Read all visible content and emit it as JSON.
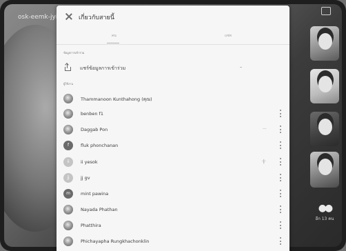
{
  "meeting": {
    "code": "osk-eemk-jyi"
  },
  "panel": {
    "title": "เกี่ยวกับสายนี้",
    "tabs": [
      "คน",
      "แชท"
    ],
    "section_share": "ข้อมูลการเข้าร่วม",
    "share_label": "แชร์ข้อมูลการเข้าร่วม",
    "section_people": "ผู้ใช้งาน"
  },
  "people": [
    {
      "name": "Thammanoon Kunthahong (คุณ)",
      "avatar": "photo",
      "initial": "",
      "extra": "",
      "menu": false
    },
    {
      "name": "benben f1",
      "avatar": "photo",
      "initial": "",
      "extra": "",
      "menu": true
    },
    {
      "name": "Daggab Pon",
      "avatar": "photo",
      "initial": "",
      "extra": "···",
      "menu": true
    },
    {
      "name": "fluk phonchanan",
      "avatar": "dark",
      "initial": "f",
      "extra": "",
      "menu": true
    },
    {
      "name": "ii yesok",
      "avatar": "light",
      "initial": "ii",
      "extra": "·|·",
      "menu": true
    },
    {
      "name": "jj gv",
      "avatar": "light",
      "initial": "jj",
      "extra": "",
      "menu": true
    },
    {
      "name": "mint pawina",
      "avatar": "dark",
      "initial": "m",
      "extra": "",
      "menu": true
    },
    {
      "name": "Nayada Phathan",
      "avatar": "photo",
      "initial": "",
      "extra": "",
      "menu": true
    },
    {
      "name": "Phatthira",
      "avatar": "photo",
      "initial": "",
      "extra": "",
      "menu": true
    },
    {
      "name": "Phichayapha Rungkhachonklin",
      "avatar": "photo",
      "initial": "",
      "extra": "",
      "menu": true
    }
  ],
  "side": {
    "others_label": "อีก 13 คน"
  }
}
